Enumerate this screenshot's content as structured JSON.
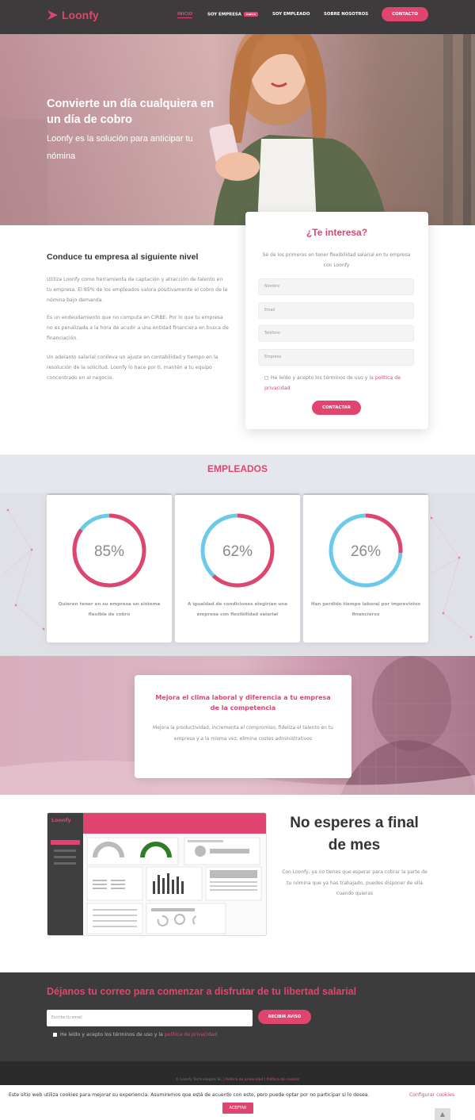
{
  "header": {
    "logo_text": "Loonfy",
    "nav": [
      {
        "label": "INICIO"
      },
      {
        "label": "SOY EMPRESA",
        "badge": "nuevo"
      },
      {
        "label": "SOY EMPLEADO"
      },
      {
        "label": "SOBRE NOSOTROS"
      }
    ],
    "contact_button": "CONTACTO"
  },
  "hero": {
    "title": "Convierte un día cualquiera en un día de cobro",
    "subtitle": "Loonfy es la solución para anticipar tu nómina"
  },
  "intro": {
    "title": "Conduce tu empresa al siguiente nivel",
    "paragraphs": [
      "Utiliza Loonfy como herramienta de captación y atracción de talento en tu empresa. El 85% de los empleados valora positivamente el cobro de la nómina bajo demanda.",
      "Es un endeudamiento que no computa en CIRBE. Por lo que tu empresa no es penalizada a la hora de acudir a una entidad financiera en busca de financiación.",
      "Un adelanto salarial conlleva un ajuste en contabilidad y tiempo en la resolución de la solicitud. Loonfy lo hace por ti, mantén a tu equipo concentrado en el negocio."
    ]
  },
  "form": {
    "title": "¿Te interesa?",
    "subtitle": "Sé de los primeros en tener flexibilidad salarial en tu empresa con Loonfy",
    "fields": [
      {
        "placeholder": "Nombre"
      },
      {
        "placeholder": "Email"
      },
      {
        "placeholder": "Teléfono"
      },
      {
        "placeholder": "Empresa"
      }
    ],
    "consent_text": "He leído y acepto los términos de uso y la",
    "consent_link": "política de privacidad",
    "submit": "CONTACTAR"
  },
  "employees": {
    "title": "EMPLEADOS",
    "stats": [
      {
        "value": "85%",
        "fraction": 0.85,
        "label": "Quieren tener en su empresa un sistema flexible de cobro"
      },
      {
        "value": "62%",
        "fraction": 0.62,
        "label": "A igualdad de condiciones elegirían una empresa con flexibilidad salarial"
      },
      {
        "value": "26%",
        "fraction": 0.26,
        "label": "Han perdido tiempo laboral por imprevistos financieros"
      }
    ],
    "colors": {
      "primary": "#e0456f",
      "secondary": "#6cc9ea"
    }
  },
  "climate": {
    "title": "Mejora el clima laboral y diferencia a tu empresa de la competencia",
    "text": "Mejora la productividad, incrementa el compromiso, fideliza el talento en tu empresa y a la misma vez, elimina costes administrativos"
  },
  "dashboard": {
    "logo_text": "Loonfy"
  },
  "month_end": {
    "title": "No esperes a final de mes",
    "text": "Con Loonfy, ya no tienes que esperar para cobrar la parte de tu nómina que ya has trabajado, puedes disponer de ella cuando quieras"
  },
  "newsletter": {
    "title": "Déjanos tu correo para comenzar a disfrutar de tu libertad salarial",
    "placeholder": "Escribe tu email",
    "button": "RECIBIR AVISO",
    "consent_text": "He leído y acepto los términos de uso y la",
    "consent_link": "política de privacidad"
  },
  "footer": {
    "text": "© Loonfy Technologies SL",
    "link1": "Política de privacidad",
    "link2": "Política de cookies"
  },
  "cookie_bar": {
    "text": "Este sitio web utiliza cookies para mejorar su experiencia. Asumiremos que está de acuerdo con esto, pero puede optar por no participar si lo desea.",
    "settings_link": "Configurar cookies",
    "accept": "ACEPTAR",
    "scroll_top_icon": "chevron-up-icon"
  },
  "brand": {
    "accent": "#e0456f",
    "dark": "#3e3b3c"
  }
}
